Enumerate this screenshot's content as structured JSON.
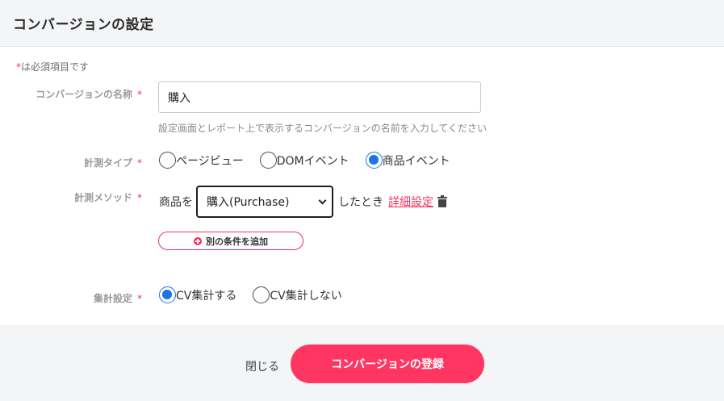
{
  "header": {
    "title": "コンバージョンの設定"
  },
  "form": {
    "required_note": "は必須項目です",
    "required_mark": "*",
    "name": {
      "label": "コンバージョンの名称",
      "value": "購入",
      "help": "設定画面とレポート上で表示するコンバージョンの名前を入力してください"
    },
    "measure_type": {
      "label": "計測タイプ",
      "options": [
        {
          "label": "ページビュー",
          "checked": false
        },
        {
          "label": "DOMイベント",
          "checked": false
        },
        {
          "label": "商品イベント",
          "checked": true
        }
      ]
    },
    "measure_method": {
      "label": "計測メソッド",
      "prefix": "商品を",
      "selected": "購入(Purchase)",
      "suffix": "したとき",
      "detail_link": "詳細設定",
      "trash_icon": "trash-icon"
    },
    "add_condition": {
      "label": "別の条件を追加",
      "icon": "plus-circle-icon"
    },
    "aggregate": {
      "label": "集計設定",
      "options": [
        {
          "label": "CV集計する",
          "checked": true
        },
        {
          "label": "CV集計しない",
          "checked": false
        }
      ]
    }
  },
  "footer": {
    "close_label": "閉じる",
    "submit_label": "コンバージョンの登録"
  },
  "colors": {
    "accent": "#ff3562",
    "radio_checked": "#1a73e8",
    "header_bg": "#f4f5f7"
  }
}
